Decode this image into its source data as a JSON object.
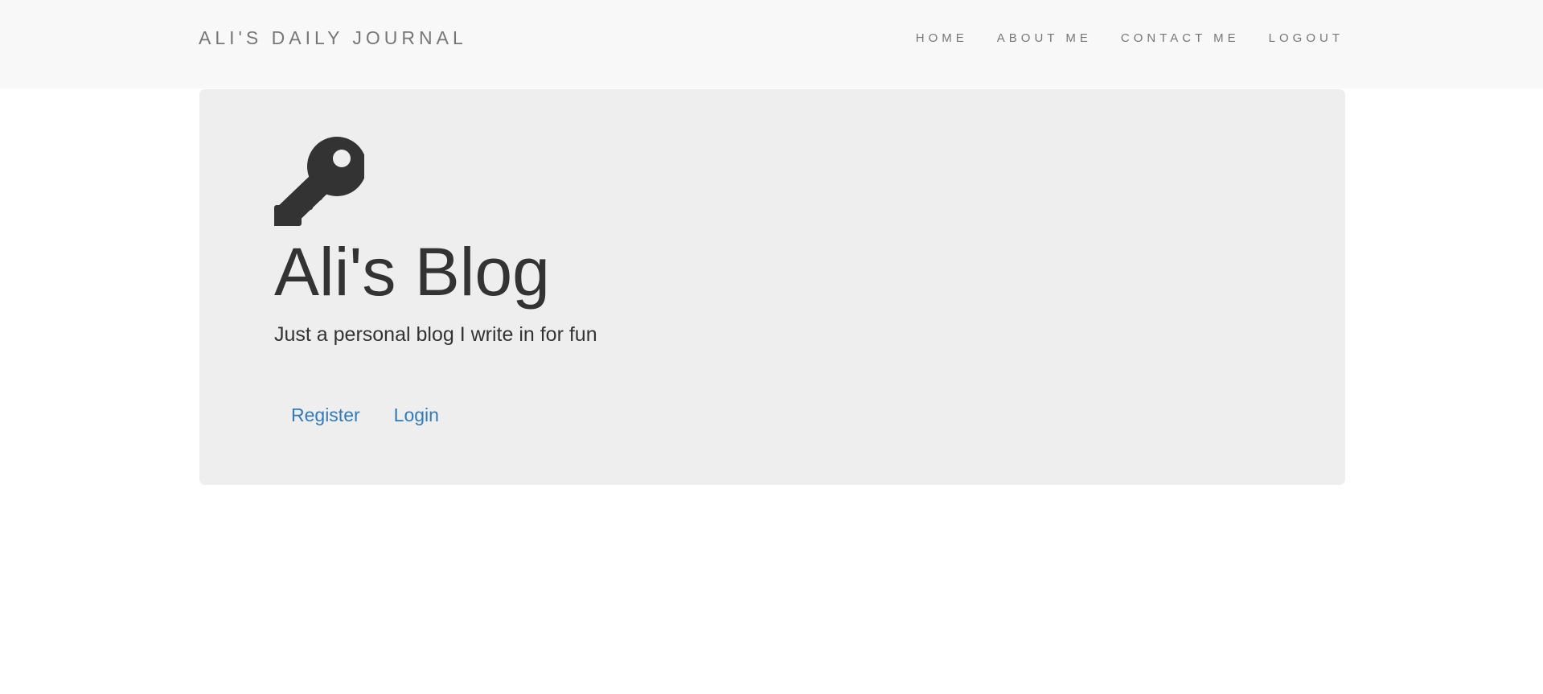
{
  "navbar": {
    "brand": "ALI'S DAILY JOURNAL",
    "links": [
      {
        "label": "HOME"
      },
      {
        "label": "ABOUT ME"
      },
      {
        "label": "CONTACT ME"
      },
      {
        "label": "LOGOUT"
      }
    ]
  },
  "hero": {
    "icon": "key-icon",
    "title": "Ali's Blog",
    "tagline": "Just a personal blog I write in for fun",
    "actions": [
      {
        "label": "Register"
      },
      {
        "label": "Login"
      }
    ]
  },
  "colors": {
    "navbar_bg": "#f8f8f8",
    "nav_text": "#777777",
    "jumbotron_bg": "#eeeeee",
    "text": "#333333",
    "link": "#337ab7"
  }
}
